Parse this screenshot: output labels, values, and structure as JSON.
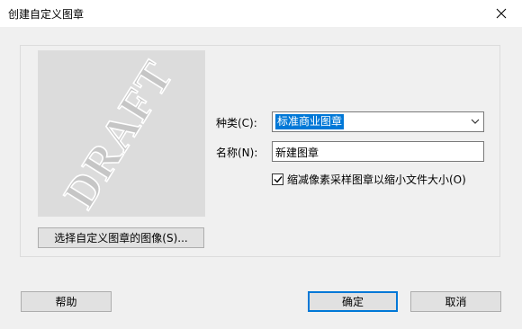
{
  "window": {
    "title": "创建自定义图章",
    "close_icon": "close-icon"
  },
  "preview": {
    "watermark_text": "DRAFT"
  },
  "buttons": {
    "select_image": "选择自定义图章的图像(S)...",
    "help": "帮助",
    "ok": "确定",
    "cancel": "取消"
  },
  "form": {
    "category_label": "种类(C):",
    "category_value": "标准商业图章",
    "name_label": "名称(N):",
    "name_value": "新建图章",
    "downsample_label": "缩减像素采样图章以缩小文件大小(O)",
    "downsample_checked": true
  },
  "colors": {
    "selection": "#0078d7",
    "default_button_border": "#0078d7"
  }
}
